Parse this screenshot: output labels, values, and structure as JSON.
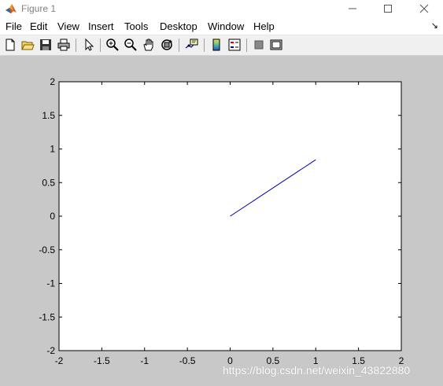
{
  "window": {
    "title": "Figure 1",
    "icon": "matlab-logo-icon"
  },
  "menu": {
    "items": [
      "File",
      "Edit",
      "View",
      "Insert",
      "Tools",
      "Desktop",
      "Window",
      "Help"
    ],
    "overflow_icon": "dock-arrow-icon"
  },
  "toolbar": {
    "buttons": [
      "new-figure-icon",
      "open-file-icon",
      "save-figure-icon",
      "print-figure-icon",
      "edit-plot-icon",
      "zoom-in-icon",
      "zoom-out-icon",
      "pan-icon",
      "rotate-3d-icon",
      "data-cursor-icon",
      "insert-colorbar-icon",
      "insert-legend-icon",
      "hide-plot-tools-icon",
      "show-plot-tools-icon"
    ]
  },
  "watermark": "https://blog.csdn.net/weixin_43822880",
  "chart_data": {
    "type": "line",
    "title": "",
    "xlabel": "",
    "ylabel": "",
    "xlim": [
      -2,
      2
    ],
    "ylim": [
      -2,
      2
    ],
    "xticks": [
      "-2",
      "-1.5",
      "-1",
      "-0.5",
      "0",
      "0.5",
      "1",
      "1.5",
      "2"
    ],
    "yticks": [
      "2",
      "1.5",
      "1",
      "0.5",
      "0",
      "-0.5",
      "-1",
      "-1.5",
      "-2"
    ],
    "grid": false,
    "series": [
      {
        "color": "#0000b4",
        "x": [
          0,
          1
        ],
        "y": [
          0,
          0.84
        ]
      }
    ]
  }
}
